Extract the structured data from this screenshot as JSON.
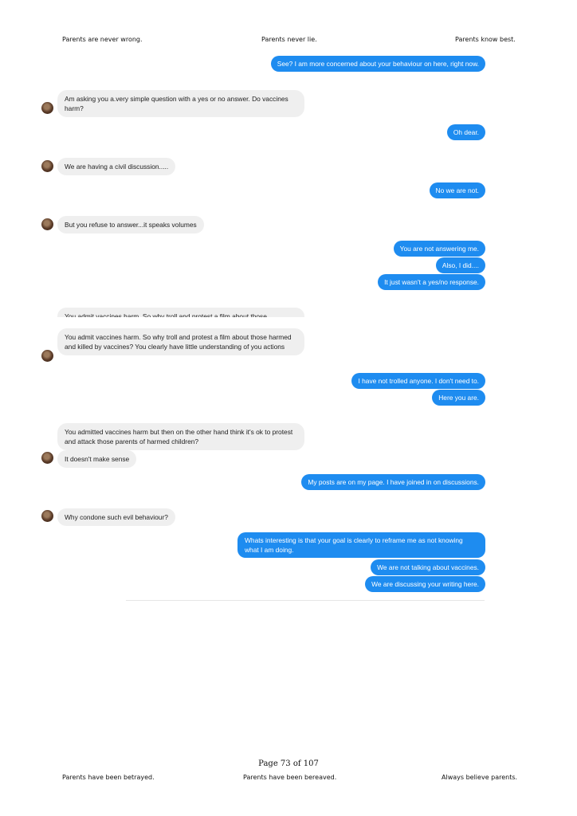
{
  "header": {
    "left": "Parents are never wrong.",
    "center": "Parents never lie.",
    "right": "Parents know best."
  },
  "messages": [
    {
      "side": "out",
      "text": "See? I am more concerned about your behaviour on here, right now."
    },
    {
      "side": "in",
      "text": "Am asking you a.very simple question with a yes or no answer. Do vaccines harm?"
    },
    {
      "side": "out",
      "text": "Oh dear."
    },
    {
      "side": "in",
      "text": "We are having a civil discussion....."
    },
    {
      "side": "out",
      "text": "No we are not."
    },
    {
      "side": "in",
      "text": "But you refuse to answer...it speaks volumes"
    },
    {
      "side": "out",
      "text": "You are not answering me."
    },
    {
      "side": "out",
      "text": "Also, I did...."
    },
    {
      "side": "out",
      "text": "It just wasn't a yes/no response."
    },
    {
      "side": "in",
      "text": "You admit vaccines harm. So why troll and protest a film about those"
    },
    {
      "side": "in",
      "text": "You admit vaccines harm. So why troll and protest a film about those harmed and killed by vaccines? You clearly have little understanding of you actions"
    },
    {
      "side": "out",
      "text": "I have not trolled anyone. I don't need to."
    },
    {
      "side": "out",
      "text": "Here you are."
    },
    {
      "side": "in",
      "text": "You admitted vaccines harm but then on the other hand think it's ok to protest and attack those parents of harmed children?"
    },
    {
      "side": "in",
      "text": "It doesn't make sense"
    },
    {
      "side": "out",
      "text": "My posts are on my page. I have joined in on discussions."
    },
    {
      "side": "in",
      "text": "Why condone such evil behaviour?"
    },
    {
      "side": "out",
      "text": "Whats interesting is that your goal is clearly to reframe me as not knowing what I am doing."
    },
    {
      "side": "out",
      "text": "We are not talking about vaccines."
    },
    {
      "side": "out",
      "text": "We are discussing your writing here."
    }
  ],
  "footer": {
    "page": "Page 73 of 107",
    "left": "Parents have been betrayed.",
    "center": "Parents have been bereaved.",
    "right": "Always believe parents."
  },
  "colors": {
    "outgoing_bubble": "#1e8cf0",
    "incoming_bubble": "#efefef"
  }
}
